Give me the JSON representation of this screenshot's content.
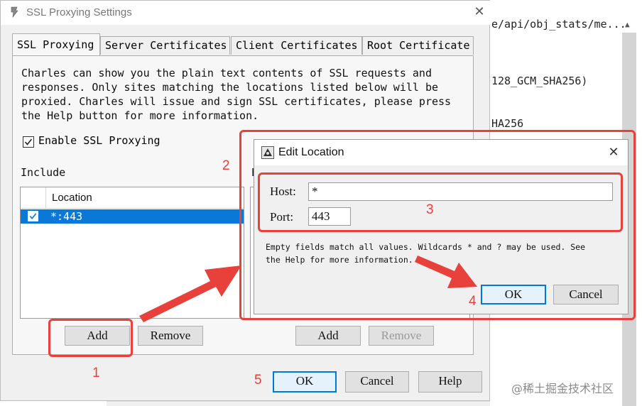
{
  "background": {
    "lines": [
      "e/api/obj_stats/me...",
      "128_GCM_SHA256)",
      "HA256"
    ],
    "scroll_arrow": "▲"
  },
  "dialog": {
    "title": "SSL Proxying Settings",
    "close_glyph": "✕",
    "tabs": [
      "SSL Proxying",
      "Server Certificates",
      "Client Certificates",
      "Root Certificate"
    ],
    "description": [
      "Charles can show you the plain text contents of SSL requests and",
      "responses. Only sites matching the locations listed below will be",
      "proxied. Charles will issue and sign SSL certificates, please press",
      "the Help button for more information."
    ],
    "enable_label": "Enable SSL Proxying",
    "enable_checked": true,
    "include_label": "Include",
    "exclude_label": "E",
    "location_header": "Location",
    "include_rows": [
      {
        "checked": true,
        "location": "*:443"
      }
    ],
    "include_buttons": {
      "add": "Add",
      "remove": "Remove"
    },
    "exclude_buttons": {
      "add": "Add",
      "remove": "Remove"
    },
    "footer_buttons": {
      "ok": "OK",
      "cancel": "Cancel",
      "help": "Help"
    }
  },
  "edit_location": {
    "title": "Edit Location",
    "close_glyph": "✕",
    "host_label": "Host:",
    "host_value": "*",
    "port_label": "Port:",
    "port_value": "443",
    "hint": [
      "Empty fields match all values. Wildcards * and ? may be used. See",
      "the Help for more information."
    ],
    "ok": "OK",
    "cancel": "Cancel"
  },
  "annotations": {
    "n1": "1",
    "n2": "2",
    "n3": "3",
    "n4": "4",
    "n5": "5",
    "color": "#e8403a"
  },
  "watermark": "@稀土掘金技术社区",
  "colors": {
    "selection": "#0a78d6",
    "primary_border": "#0078d7",
    "dialog_bg": "#f0f0f0"
  }
}
